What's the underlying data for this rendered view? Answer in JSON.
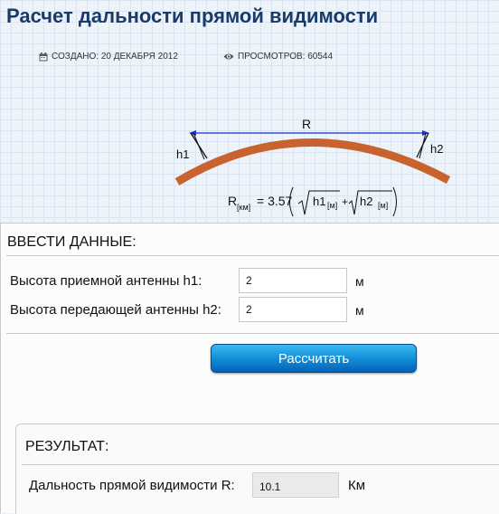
{
  "page": {
    "title": "Расчет дальности прямой видимости",
    "created_label": "СОЗДАНО: 20 ДЕКАБРЯ 2012",
    "views_label": "ПРОСМОТРОВ: 60544"
  },
  "diagram": {
    "distance_label": "R",
    "h1_label": "h1",
    "h2_label": "h2",
    "formula": {
      "lhs": "R",
      "lhs_unit": "[км]",
      "equals_const": "= 3.57",
      "term1": "h1",
      "term1_unit": "[м]",
      "plus": "+",
      "term2": "h2",
      "term2_unit": "[м]"
    },
    "colors": {
      "earth_arc": "#c8622f",
      "range_line": "#1a2fd0"
    }
  },
  "input": {
    "heading": "ВВЕСТИ ДАННЫЕ:",
    "h1_label": "Высота приемной антенны h1:",
    "h1_value": "2",
    "h1_unit": "м",
    "h2_label": "Высота передающей антенны h2:",
    "h2_value": "2",
    "h2_unit": "м",
    "calculate_label": "Рассчитать"
  },
  "result": {
    "heading": "РЕЗУЛЬТАТ:",
    "label": "Дальность прямой видимости R:",
    "value": "10.1",
    "unit": "Км"
  },
  "icons": {
    "created": "calendar-icon",
    "views": "eye-icon"
  }
}
